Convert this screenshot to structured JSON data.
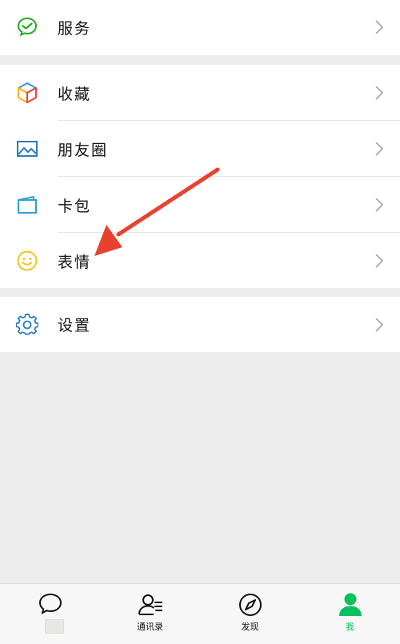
{
  "menu": {
    "services": {
      "label": "服务",
      "icon": "wechat-pay-check-icon"
    },
    "items": [
      {
        "label": "收藏",
        "icon": "favorites-cube-icon"
      },
      {
        "label": "朋友圈",
        "icon": "moments-photo-icon"
      },
      {
        "label": "卡包",
        "icon": "card-wallet-icon"
      },
      {
        "label": "表情",
        "icon": "smiley-icon"
      }
    ],
    "settings": {
      "label": "设置",
      "icon": "gear-icon"
    }
  },
  "tabbar": {
    "tabs": [
      {
        "label": "",
        "icon": "chat-bubble-icon"
      },
      {
        "label": "通讯录",
        "icon": "contacts-icon"
      },
      {
        "label": "发现",
        "icon": "compass-icon"
      },
      {
        "label": "我",
        "icon": "person-icon",
        "active": true
      }
    ]
  },
  "colors": {
    "accent": "#07c160",
    "arrow": "#e8422f",
    "background": "#ededed"
  }
}
